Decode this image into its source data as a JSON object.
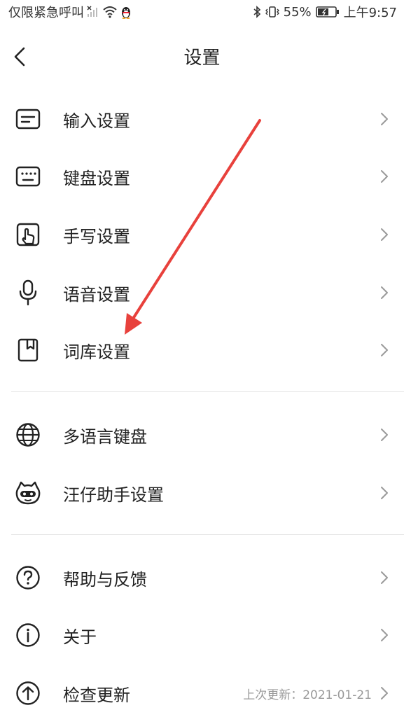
{
  "status_bar": {
    "carrier": "仅限紧急呼叫",
    "battery": "55%",
    "time": "上午9:57"
  },
  "header": {
    "title": "设置"
  },
  "groups": [
    {
      "items": [
        {
          "label": "输入设置",
          "icon": "text-box-icon"
        },
        {
          "label": "键盘设置",
          "icon": "keyboard-icon"
        },
        {
          "label": "手写设置",
          "icon": "handwriting-icon"
        },
        {
          "label": "语音设置",
          "icon": "microphone-icon"
        },
        {
          "label": "词库设置",
          "icon": "dictionary-icon"
        }
      ]
    },
    {
      "items": [
        {
          "label": "多语言键盘",
          "icon": "globe-icon"
        },
        {
          "label": "汪仔助手设置",
          "icon": "mascot-icon"
        }
      ]
    },
    {
      "items": [
        {
          "label": "帮助与反馈",
          "icon": "question-icon"
        },
        {
          "label": "关于",
          "icon": "info-icon"
        },
        {
          "label": "检查更新",
          "icon": "upload-arrow-icon",
          "meta": "上次更新：2021-01-21"
        }
      ]
    }
  ],
  "colors": {
    "annotation_arrow": "#e8413c",
    "divider": "#e6e6e6",
    "meta_text": "#9a9a9a"
  }
}
